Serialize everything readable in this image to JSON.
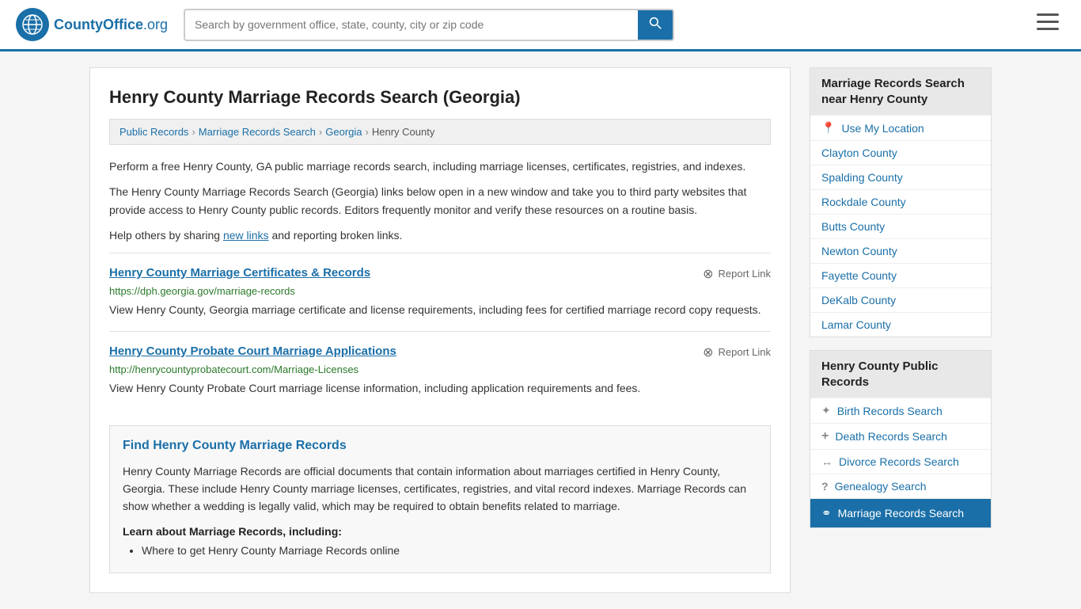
{
  "header": {
    "logo_icon": "🌐",
    "logo_name": "CountyOffice",
    "logo_org": ".org",
    "search_placeholder": "Search by government office, state, county, city or zip code",
    "search_icon": "🔍",
    "menu_icon": "≡"
  },
  "page": {
    "title": "Henry County Marriage Records Search (Georgia)",
    "breadcrumb": [
      {
        "label": "Public Records",
        "href": "#"
      },
      {
        "label": "Marriage Records Search",
        "href": "#"
      },
      {
        "label": "Georgia",
        "href": "#"
      },
      {
        "label": "Henry County",
        "href": "#"
      }
    ],
    "intro1": "Perform a free Henry County, GA public marriage records search, including marriage licenses, certificates, registries, and indexes.",
    "intro2": "The Henry County Marriage Records Search (Georgia) links below open in a new window and take you to third party websites that provide access to Henry County public records. Editors frequently monitor and verify these resources on a routine basis.",
    "intro3_prefix": "Help others by sharing ",
    "intro3_link": "new links",
    "intro3_suffix": " and reporting broken links.",
    "records": [
      {
        "title": "Henry County Marriage Certificates & Records",
        "url": "https://dph.georgia.gov/marriage-records",
        "description": "View Henry County, Georgia marriage certificate and license requirements, including fees for certified marriage record copy requests.",
        "report_label": "Report Link"
      },
      {
        "title": "Henry County Probate Court Marriage Applications",
        "url": "http://henrycountyprobatecourt.com/Marriage-Licenses",
        "description": "View Henry County Probate Court marriage license information, including application requirements and fees.",
        "report_label": "Report Link"
      }
    ],
    "find_section": {
      "title": "Find Henry County Marriage Records",
      "text": "Henry County Marriage Records are official documents that contain information about marriages certified in Henry County, Georgia. These include Henry County marriage licenses, certificates, registries, and vital record indexes. Marriage Records can show whether a wedding is legally valid, which may be required to obtain benefits related to marriage.",
      "learn_title": "Learn about Marriage Records, including:",
      "learn_items": [
        "Where to get Henry County Marriage Records online"
      ]
    }
  },
  "sidebar": {
    "nearby_title": "Marriage Records Search near Henry County",
    "use_my_location": "Use My Location",
    "nearby_counties": [
      "Clayton County",
      "Spalding County",
      "Rockdale County",
      "Butts County",
      "Newton County",
      "Fayette County",
      "DeKalb County",
      "Lamar County"
    ],
    "public_records_title": "Henry County Public Records",
    "public_records_items": [
      {
        "label": "Birth Records Search",
        "icon": "birth",
        "active": false
      },
      {
        "label": "Death Records Search",
        "icon": "death",
        "active": false
      },
      {
        "label": "Divorce Records Search",
        "icon": "divorce",
        "active": false
      },
      {
        "label": "Genealogy Search",
        "icon": "genealogy",
        "active": false
      },
      {
        "label": "Marriage Records Search",
        "icon": "marriage",
        "active": true
      }
    ]
  }
}
